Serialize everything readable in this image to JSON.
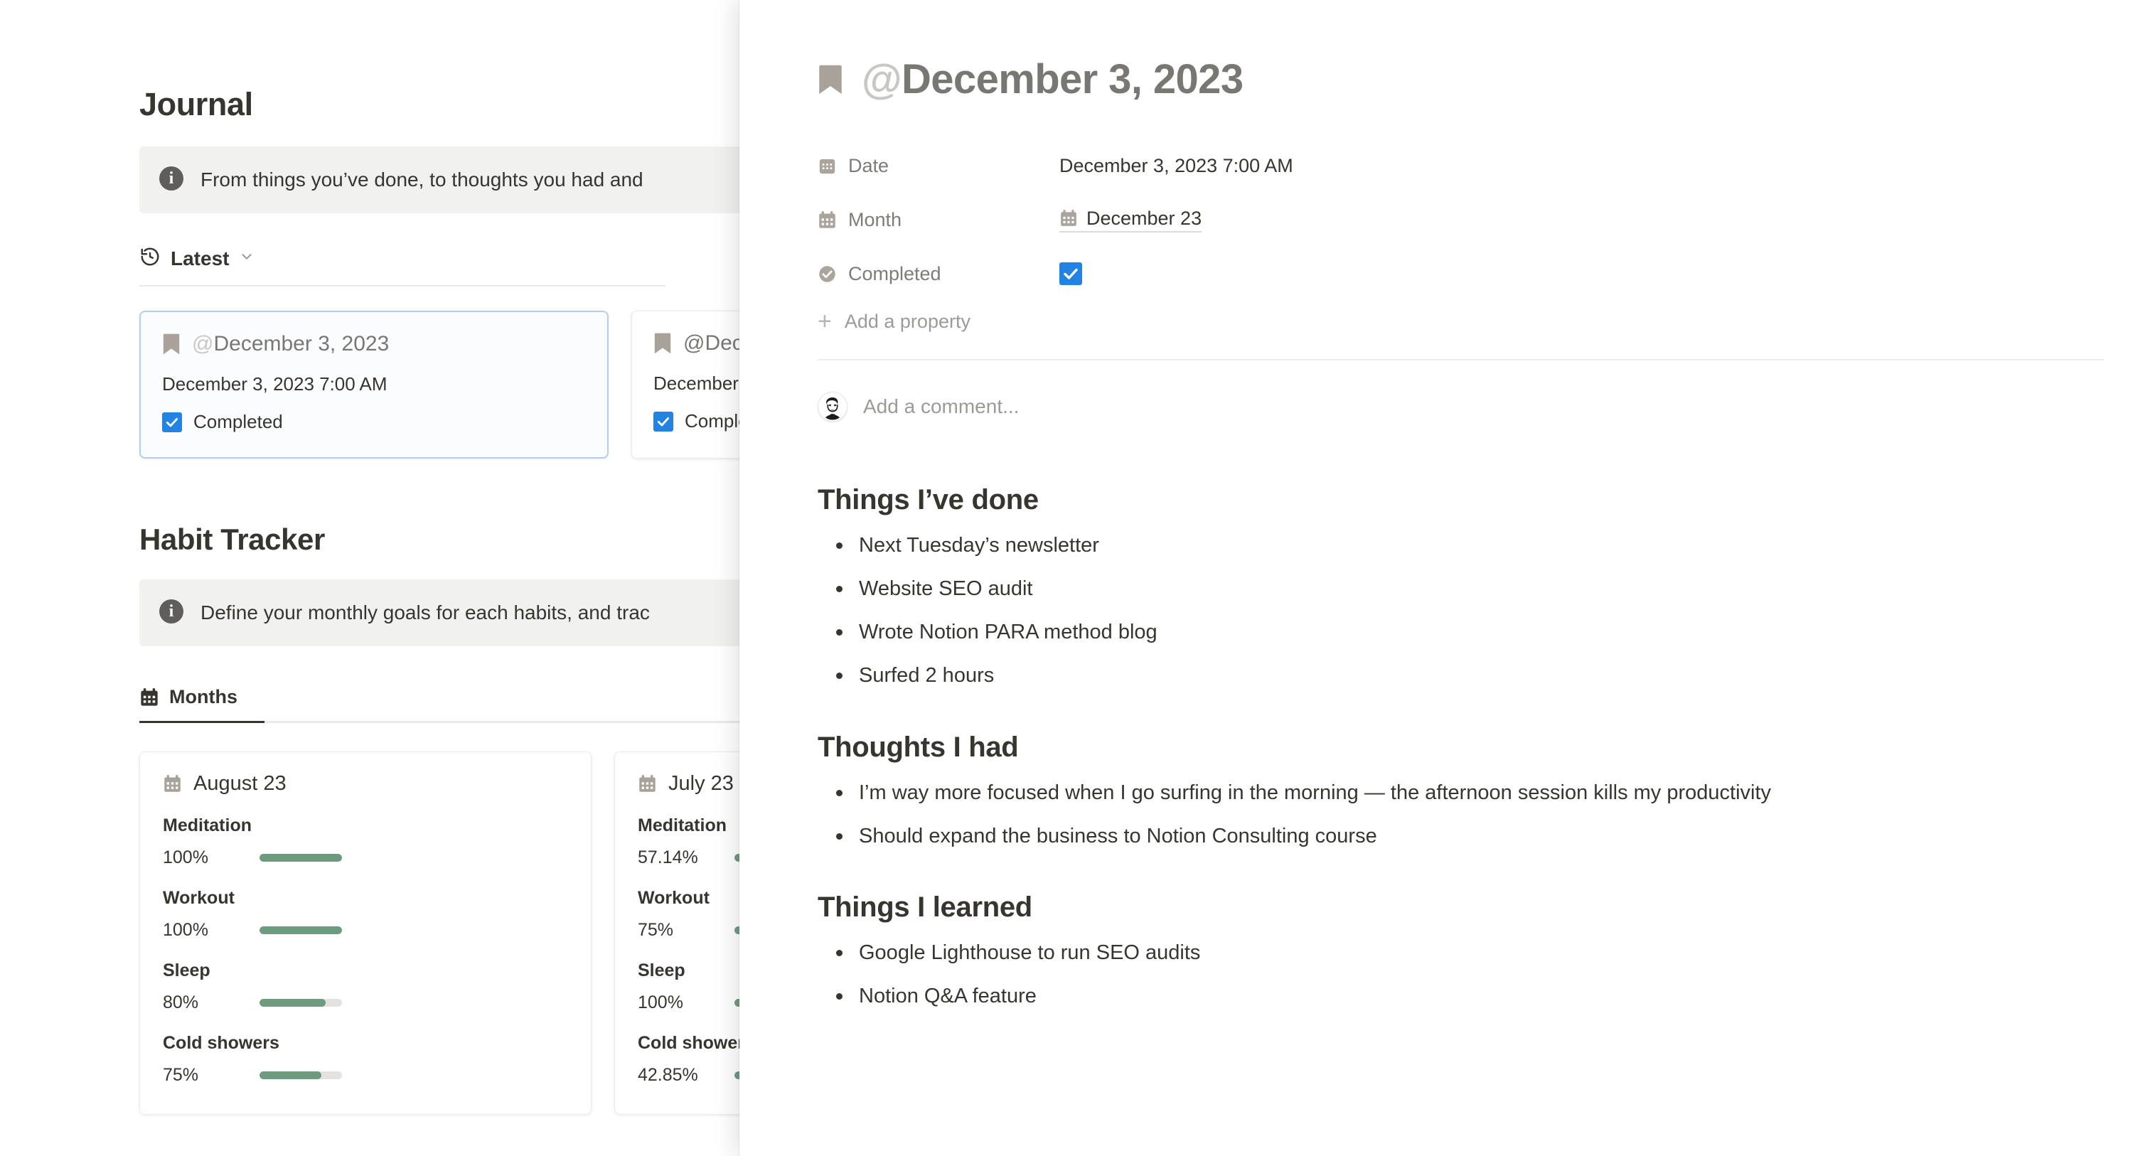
{
  "background_page": {
    "journal": {
      "heading": "Journal",
      "callout": {
        "icon": "info-icon",
        "text": "From things you’ve done, to thoughts you had and"
      },
      "view": {
        "icon": "recent-clock-icon",
        "label": "Latest",
        "chevron": "chevron-down-icon"
      },
      "cards": [
        {
          "icon": "bookmark-icon",
          "at": "@",
          "title": "December 3, 2023",
          "date": "December 3, 2023 7:00 AM",
          "checkbox_checked": true,
          "checkbox_label": "Completed",
          "selected": true
        },
        {
          "icon": "bookmark-icon",
          "at": "@",
          "title": "@Dece",
          "date": "December ",
          "checkbox_checked": true,
          "checkbox_label": "Comple",
          "selected": false
        }
      ]
    },
    "habit_tracker": {
      "heading": "Habit Tracker",
      "callout": {
        "icon": "info-icon",
        "text": "Define your monthly goals for each habits, and trac"
      },
      "tab": {
        "icon": "calendar-icon",
        "label": "Months",
        "active": true
      },
      "month_cards": [
        {
          "icon": "calendar-icon",
          "month": "August 23",
          "habits": [
            {
              "name": "Meditation",
              "percent_label": "100%",
              "percent": 100
            },
            {
              "name": "Workout",
              "percent_label": "100%",
              "percent": 100
            },
            {
              "name": "Sleep",
              "percent_label": "80%",
              "percent": 80
            },
            {
              "name": "Cold showers",
              "percent_label": "75%",
              "percent": 75
            }
          ]
        },
        {
          "icon": "calendar-icon",
          "month": "July 23",
          "habits": [
            {
              "name": "Meditation",
              "percent_label": "57.14%",
              "percent": 57.14
            },
            {
              "name": "Workout",
              "percent_label": "75%",
              "percent": 75
            },
            {
              "name": "Sleep",
              "percent_label": "100%",
              "percent": 100
            },
            {
              "name": "Cold showers",
              "percent_label": "42.85%",
              "percent": 42.85
            }
          ]
        }
      ]
    }
  },
  "panel": {
    "title": {
      "icon": "bookmark-icon",
      "at": "@",
      "text": "December 3, 2023"
    },
    "properties": [
      {
        "icon": "calendar-date-icon",
        "label": "Date",
        "type": "date",
        "value": "December 3, 2023 7:00 AM"
      },
      {
        "icon": "calendar-icon",
        "label": "Month",
        "type": "relation",
        "value": "December 23",
        "value_icon": "calendar-icon"
      },
      {
        "icon": "check-circle-icon",
        "label": "Completed",
        "type": "checkbox",
        "checked": true
      }
    ],
    "add_property": {
      "icon": "plus-icon",
      "label": "Add a property"
    },
    "comment": {
      "avatar": "user-avatar",
      "placeholder": "Add a comment..."
    },
    "sections": [
      {
        "heading": "Things I’ve done",
        "items": [
          "Next Tuesday’s newsletter",
          "Website SEO audit",
          "Wrote Notion PARA method blog",
          "Surfed 2 hours"
        ]
      },
      {
        "heading": "Thoughts I had",
        "items": [
          "I’m way more focused when I go surfing in the morning — the afternoon session kills my productivity",
          "Should expand the business to Notion Consulting course"
        ]
      },
      {
        "heading": "Things I learned",
        "items": [
          "Google Lighthouse to run SEO audits",
          "Notion Q&A feature"
        ]
      }
    ]
  },
  "colors": {
    "accent_blue": "#2383e2",
    "progress_green": "#6c9b7e",
    "progress_track": "#e3e2e0",
    "text_primary": "#37352f",
    "text_muted": "#9b9a97",
    "callout_bg": "#f1f1ef",
    "selected_card_border": "#b4cdf0"
  }
}
